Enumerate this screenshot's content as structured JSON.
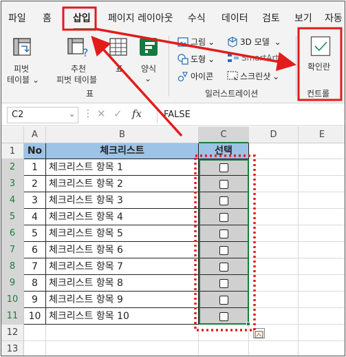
{
  "tabs": [
    "파일",
    "홈",
    "삽입",
    "페이지 레이아웃",
    "수식",
    "데이터",
    "검토",
    "보기",
    "자동"
  ],
  "ribbon": {
    "pivot_table": "피벗",
    "pivot_table_2": "테이블",
    "recommended": "추천",
    "recommended_2": "피벗 테이블",
    "table": "표",
    "forms": "양식",
    "group_table": "표",
    "picture": "그림",
    "shapes": "도형",
    "icons": "아이콘",
    "model_3d": "3D 모델",
    "smartart": "SmartArt",
    "screenshot": "스크린샷",
    "group_illustration": "일러스트레이션",
    "checkbox": "확인란",
    "group_controls": "컨트롤"
  },
  "formula_bar": {
    "name_box": "C2",
    "fx": "fx",
    "value": "FALSE"
  },
  "columns": [
    "A",
    "B",
    "C",
    "D",
    "E"
  ],
  "rows": [
    "1",
    "2",
    "3",
    "4",
    "5",
    "6",
    "7",
    "8",
    "9",
    "10",
    "11",
    "12",
    "13"
  ],
  "table": {
    "headers": [
      "No",
      "체크리스트",
      "선택"
    ],
    "items": [
      {
        "no": "1",
        "text": "체크리스트 항목 1"
      },
      {
        "no": "2",
        "text": "체크리스트 항목 2"
      },
      {
        "no": "3",
        "text": "체크리스트 항목 3"
      },
      {
        "no": "4",
        "text": "체크리스트 항목 4"
      },
      {
        "no": "5",
        "text": "체크리스트 항목 5"
      },
      {
        "no": "6",
        "text": "체크리스트 항목 6"
      },
      {
        "no": "7",
        "text": "체크리스트 항목 7"
      },
      {
        "no": "8",
        "text": "체크리스트 항목 8"
      },
      {
        "no": "9",
        "text": "체크리스트 항목 9"
      },
      {
        "no": "10",
        "text": "체크리스트 항목 10"
      }
    ]
  },
  "colors": {
    "accent_red": "#e31b1b",
    "header_fill": "#9dc3e6",
    "selection_fill": "#d0d0d0",
    "excel_green": "#1e7a3e"
  }
}
